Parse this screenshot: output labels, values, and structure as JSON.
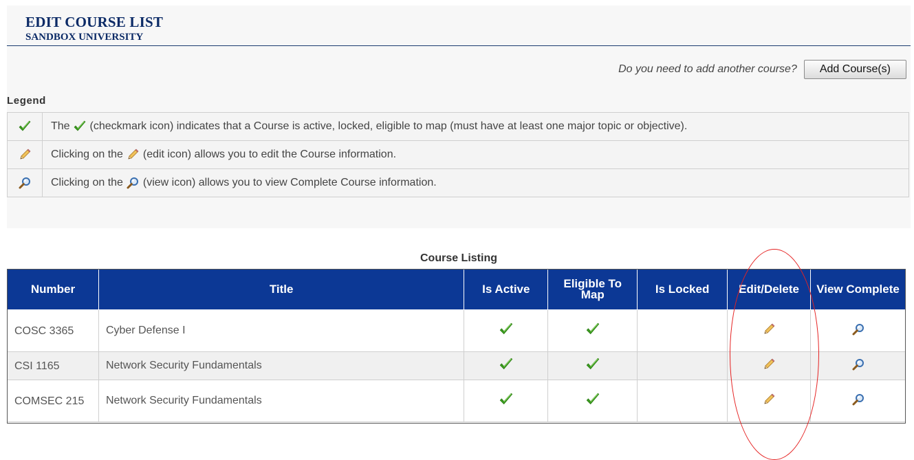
{
  "header": {
    "title": "EDIT COURSE LIST",
    "subtitle": "SANDBOX UNIVERSITY"
  },
  "add_course": {
    "question": "Do you need to add another course?",
    "button_label": "Add Course(s)"
  },
  "legend": {
    "title": "Legend",
    "rows": [
      {
        "icon": "checkmark-icon",
        "before": "The",
        "after": "(checkmark icon) indicates that a Course is active, locked, eligible to map (must have at least one major topic or objective)."
      },
      {
        "icon": "edit-icon",
        "before": "Clicking on the",
        "after": "(edit icon) allows you to edit the Course information."
      },
      {
        "icon": "view-icon",
        "before": "Clicking on the",
        "after": "(view icon) allows you to view Complete Course information."
      }
    ]
  },
  "course_listing": {
    "caption": "Course Listing",
    "columns": [
      "Number",
      "Title",
      "Is Active",
      "Eligible To Map",
      "Is Locked",
      "Edit/Delete",
      "View Complete"
    ],
    "rows": [
      {
        "number": "COSC 3365",
        "title": "Cyber Defense I",
        "is_active": true,
        "eligible_to_map": true,
        "is_locked": false
      },
      {
        "number": "CSI 1165",
        "title": "Network Security Fundamentals",
        "is_active": true,
        "eligible_to_map": true,
        "is_locked": false
      },
      {
        "number": "COMSEC 215",
        "title": "Network Security Fundamentals",
        "is_active": true,
        "eligible_to_map": true,
        "is_locked": false
      }
    ]
  },
  "colors": {
    "header_text": "#0b2a66",
    "table_header_bg": "#0c3895",
    "checkmark": "#3a9a1e",
    "annotation": "#e52222"
  }
}
